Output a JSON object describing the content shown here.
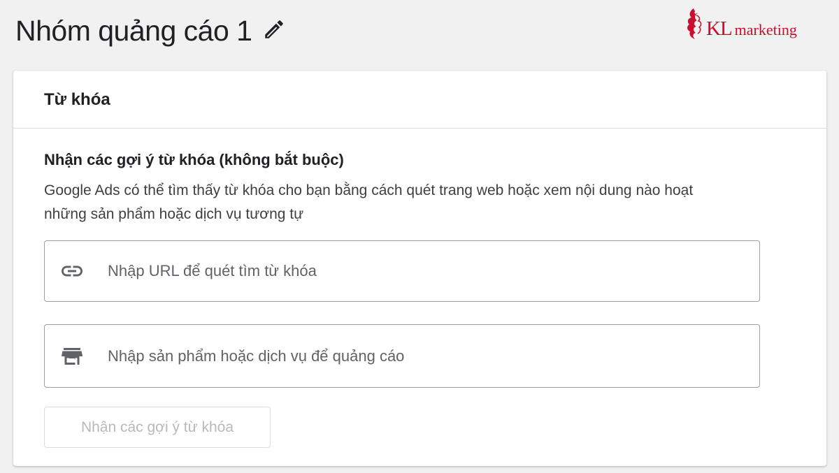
{
  "header": {
    "title": "Nhóm quảng cáo 1",
    "edit_icon": "pencil-icon",
    "logo": {
      "kl": "KL",
      "marketing": "marketing",
      "color": "#c8102e"
    }
  },
  "card": {
    "title": "Từ khóa",
    "section_heading": "Nhận các gợi ý từ khóa (không bắt buộc)",
    "description_lines": [
      "Google Ads có thể tìm thấy từ khóa cho bạn bằng cách quét trang web hoặc xem nội dung nào hoạt",
      "những sản phẩm hoặc dịch vụ tương tự"
    ],
    "url_input": {
      "icon": "link-icon",
      "placeholder": "Nhập URL để quét tìm từ khóa",
      "value": ""
    },
    "product_input": {
      "icon": "storefront-icon",
      "placeholder": "Nhập sản phẩm hoặc dịch vụ để quảng cáo",
      "value": ""
    },
    "suggest_button": {
      "label": "Nhận các gợi ý từ khóa",
      "state": "disabled"
    }
  },
  "colors": {
    "background": "#f1f1f1",
    "card": "#ffffff",
    "text": "#202124",
    "muted_text": "#5f6368",
    "disabled_text": "#b7b9bc",
    "border": "#9aa0a6",
    "brand_red": "#c8102e"
  }
}
